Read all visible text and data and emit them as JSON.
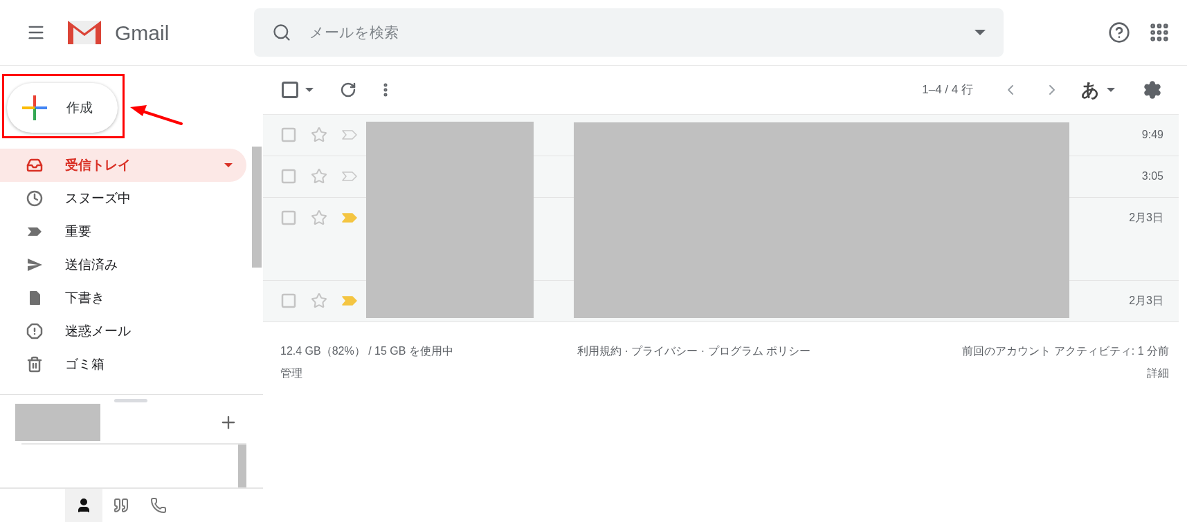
{
  "header": {
    "app_name": "Gmail",
    "search": {
      "placeholder": "メールを検索"
    }
  },
  "compose": {
    "label": "作成"
  },
  "nav": [
    {
      "label": "受信トレイ",
      "selected": true
    },
    {
      "label": "スヌーズ中",
      "selected": false
    },
    {
      "label": "重要",
      "selected": false
    },
    {
      "label": "送信済み",
      "selected": false
    },
    {
      "label": "下書き",
      "selected": false
    },
    {
      "label": "迷惑メール",
      "selected": false
    },
    {
      "label": "ゴミ箱",
      "selected": false
    }
  ],
  "toolbar": {
    "page_range": "1–4 / 4 行",
    "input_tool": "あ"
  },
  "emails": [
    {
      "kind": "normal",
      "important": false,
      "time": "9:49"
    },
    {
      "kind": "normal",
      "important": false,
      "time": "3:05"
    },
    {
      "kind": "tall",
      "important": true,
      "time": "2月3日"
    },
    {
      "kind": "normal",
      "important": true,
      "time": "2月3日"
    }
  ],
  "footer": {
    "storage": "12.4 GB（82%） / 15 GB を使用中",
    "manage": "管理",
    "links": "利用規約 · プライバシー · プログラム ポリシー",
    "activity": "前回のアカウント アクティビティ: 1 分前",
    "details": "詳細"
  },
  "bottom_tabs": [
    {
      "selected": true
    },
    {
      "selected": false
    },
    {
      "selected": false
    }
  ]
}
